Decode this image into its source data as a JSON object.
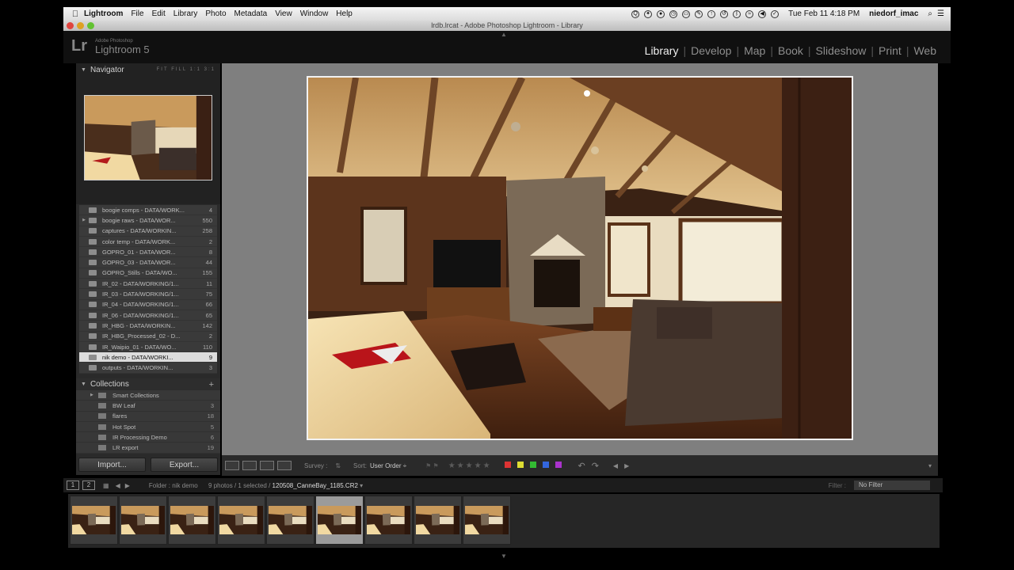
{
  "menubar": {
    "app": "Lightroom",
    "items": [
      "File",
      "Edit",
      "Library",
      "Photo",
      "Metadata",
      "View",
      "Window",
      "Help"
    ],
    "clock": "Tue Feb 11  4:18 PM",
    "user": "niedorf_imac"
  },
  "window": {
    "title": "lrdb.lrcat - Adobe Photoshop Lightroom - Library"
  },
  "logo": {
    "top_text": "Adobe Photoshop",
    "product": "Lightroom 5"
  },
  "modules": [
    "Library",
    "Develop",
    "Map",
    "Book",
    "Slideshow",
    "Print",
    "Web"
  ],
  "navigator": {
    "title": "Navigator",
    "options": "FIT FILL 1:1 3:1"
  },
  "folders": [
    {
      "name": "boogie comps - DATA/WORK...",
      "count": "4",
      "exp": ""
    },
    {
      "name": "boogie raws - DATA/WOR...",
      "count": "550",
      "exp": "▶"
    },
    {
      "name": "captures - DATA/WORKIN...",
      "count": "258",
      "exp": ""
    },
    {
      "name": "color temp - DATA/WORK...",
      "count": "2",
      "exp": ""
    },
    {
      "name": "GOPRO_01 - DATA/WOR...",
      "count": "8",
      "exp": ""
    },
    {
      "name": "GOPRO_03 - DATA/WOR...",
      "count": "44",
      "exp": ""
    },
    {
      "name": "GOPRO_Stills - DATA/WO...",
      "count": "155",
      "exp": ""
    },
    {
      "name": "IR_02 - DATA/WORKING/1...",
      "count": "11",
      "exp": ""
    },
    {
      "name": "IR_03 - DATA/WORKING/1...",
      "count": "75",
      "exp": ""
    },
    {
      "name": "IR_04 - DATA/WORKING/1...",
      "count": "66",
      "exp": ""
    },
    {
      "name": "IR_06 - DATA/WORKING/1...",
      "count": "65",
      "exp": ""
    },
    {
      "name": "IR_HBG - DATA/WORKIN...",
      "count": "142",
      "exp": ""
    },
    {
      "name": "IR_HBG_Processed_02 - D...",
      "count": "2",
      "exp": ""
    },
    {
      "name": "IR_Waipio_01 - DATA/WO...",
      "count": "110",
      "exp": ""
    },
    {
      "name": "nik demo - DATA/WORKI...",
      "count": "9",
      "exp": ""
    },
    {
      "name": "outputs - DATA/WORKIN...",
      "count": "3",
      "exp": ""
    }
  ],
  "collections": {
    "title": "Collections",
    "items": [
      {
        "name": "Smart Collections",
        "count": "",
        "exp": "▶"
      },
      {
        "name": "BW Leaf",
        "count": "3",
        "exp": ""
      },
      {
        "name": "flares",
        "count": "18",
        "exp": ""
      },
      {
        "name": "Hot Spot",
        "count": "5",
        "exp": ""
      },
      {
        "name": "IR Processing Demo",
        "count": "6",
        "exp": ""
      },
      {
        "name": "LR export",
        "count": "19",
        "exp": ""
      }
    ]
  },
  "buttons": {
    "import": "Import...",
    "export": "Export..."
  },
  "toolbar": {
    "survey": "Survey :",
    "sort_label": "Sort:",
    "sort_value": "User Order ÷",
    "stars": "★★★★★"
  },
  "label_colors": [
    "#d33",
    "#dd3",
    "#3b3",
    "#36d",
    "#a3c"
  ],
  "filmstrip_bar": {
    "page1": "1",
    "page2": "2",
    "folder": "Folder : nik demo",
    "count": "9 photos / 1 selected /",
    "file": "120508_CanneBay_1185.CR2",
    "filter_label": "Filter :",
    "no_filter": "No Filter"
  },
  "filmstrip": {
    "count": 9,
    "selected_index": 5
  }
}
